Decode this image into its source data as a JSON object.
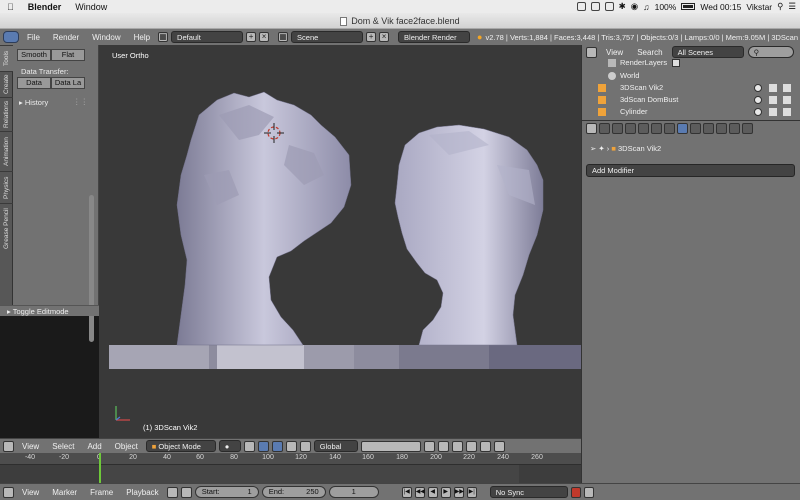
{
  "macbar": {
    "app": "Blender",
    "menu": [
      "Window"
    ],
    "battery": "100%",
    "clock": "Wed 00:15",
    "user": "Vikstar"
  },
  "window": {
    "title": "Dom & Vik face2face.blend"
  },
  "info": {
    "menus": [
      "File",
      "Render",
      "Window",
      "Help"
    ],
    "layout": "Default",
    "scene": "Scene",
    "engine": "Blender Render",
    "stats": "v2.78 | Verts:1,884 | Faces:3,448 | Tris:3,757 | Objects:0/3 | Lamps:0/0 | Mem:9.05M | 3DScan"
  },
  "tabs": [
    "Tools",
    "Create",
    "Relations",
    "Animation",
    "Physics",
    "Grease Pencil"
  ],
  "toolshelf": {
    "smooth": "Smooth",
    "flat": "Flat",
    "data_transfer": "Data Transfer:",
    "data": "Data",
    "data_la": "Data La",
    "history": "History",
    "toggle_editmode": "Toggle Editmode"
  },
  "viewport": {
    "view_label": "User Ortho",
    "object_label": "(1) 3DScan Vik2"
  },
  "outliner": {
    "view": "View",
    "search": "Search",
    "filter": "All Scenes",
    "rows": [
      "RenderLayers",
      "World",
      "3DScan Vik2",
      "3dScan DomBust",
      "Cylinder"
    ]
  },
  "properties": {
    "path_object": "3DScan Vik2",
    "add_modifier": "Add Modifier"
  },
  "viewheader": {
    "menus": [
      "View",
      "Select",
      "Add",
      "Object"
    ],
    "mode": "Object Mode",
    "orientation": "Global"
  },
  "timeline": {
    "ticks": [
      "-40",
      "-20",
      "0",
      "20",
      "40",
      "60",
      "80",
      "100",
      "120",
      "140",
      "160",
      "180",
      "200",
      "220",
      "240",
      "260"
    ],
    "menus": [
      "View",
      "Marker",
      "Frame",
      "Playback"
    ],
    "start_label": "Start:",
    "start": "1",
    "end_label": "End:",
    "end": "250",
    "current": "1",
    "sync": "No Sync"
  },
  "colors": {
    "blender_panel": "#727272",
    "viewport_bg": "#393939",
    "accent_blue": "#5a7bb1",
    "playhead": "#6ec83a"
  }
}
